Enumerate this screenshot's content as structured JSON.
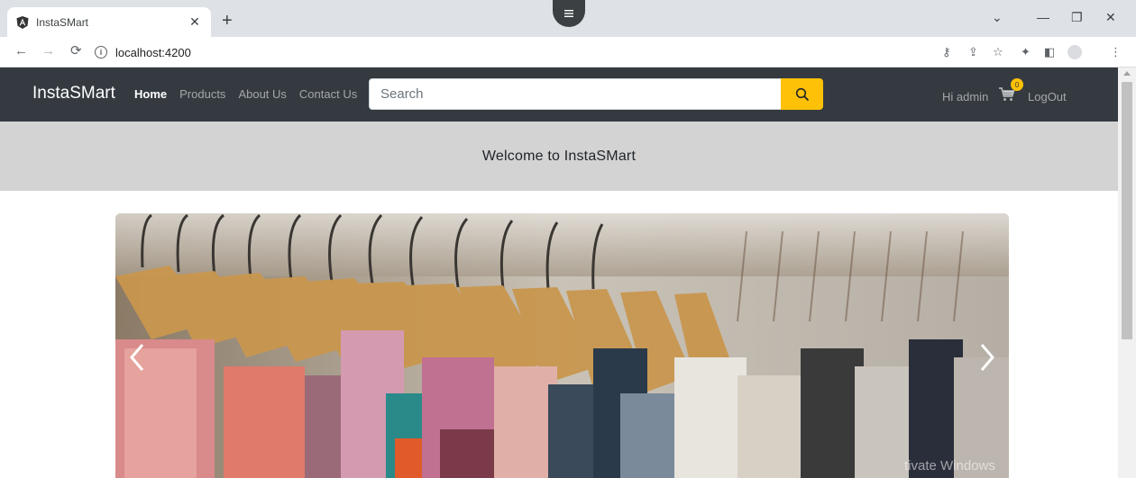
{
  "browser": {
    "tab_title": "InstaSMart",
    "url": "localhost:4200"
  },
  "navbar": {
    "brand": "InstaSMart",
    "links": [
      {
        "label": "Home",
        "active": true
      },
      {
        "label": "Products",
        "active": false
      },
      {
        "label": "About Us",
        "active": false
      },
      {
        "label": "Contact Us",
        "active": false
      }
    ],
    "search_placeholder": "Search",
    "greeting": "Hi admin",
    "cart_count": "0",
    "logout_label": "LogOut"
  },
  "welcome": {
    "heading": "Welcome to InstaSMart"
  },
  "carousel": {
    "image_description_icon": "clothes-rack-image"
  },
  "os_watermark": "tivate Windows",
  "colors": {
    "navbar_bg": "#343a40",
    "accent": "#ffc107",
    "welcome_bg": "#d3d3d3"
  }
}
